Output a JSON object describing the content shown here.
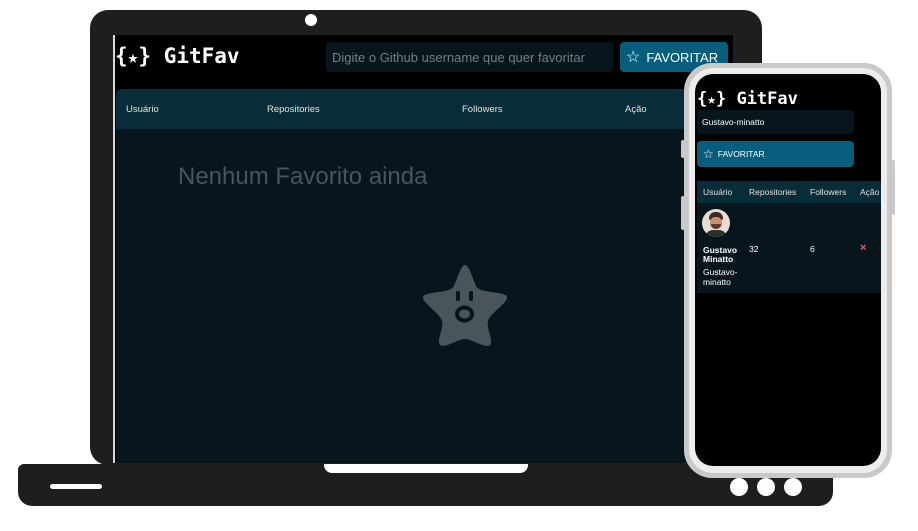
{
  "app": {
    "logo_brace_open": "{",
    "logo_star": "★",
    "logo_brace_close": "}",
    "logo_text": "GitFav"
  },
  "desktop": {
    "search_placeholder": "Digite o Github username que quer favoritar",
    "favorite_button": "FAVORITAR",
    "table_headers": [
      "Usuário",
      "Repositories",
      "Followers",
      "Ação"
    ],
    "empty_message": "Nenhum Favorito ainda"
  },
  "mobile": {
    "search_value": "Gustavo-minatto",
    "favorite_button": "FAVORITAR",
    "table_headers": [
      "Usuário",
      "Repositories",
      "Followers",
      "Ação"
    ],
    "rows": [
      {
        "name": "Gustavo Minatto",
        "login": "Gustavo-minatto",
        "repositories": "32",
        "followers": "6",
        "remove": "×"
      }
    ]
  },
  "icons": {
    "star_outline": "☆",
    "empty_state": "star-face-icon"
  },
  "colors": {
    "accent": "#065e7c",
    "table_header": "#092d38",
    "table_body": "#06161c",
    "remove": "#f75a68"
  }
}
